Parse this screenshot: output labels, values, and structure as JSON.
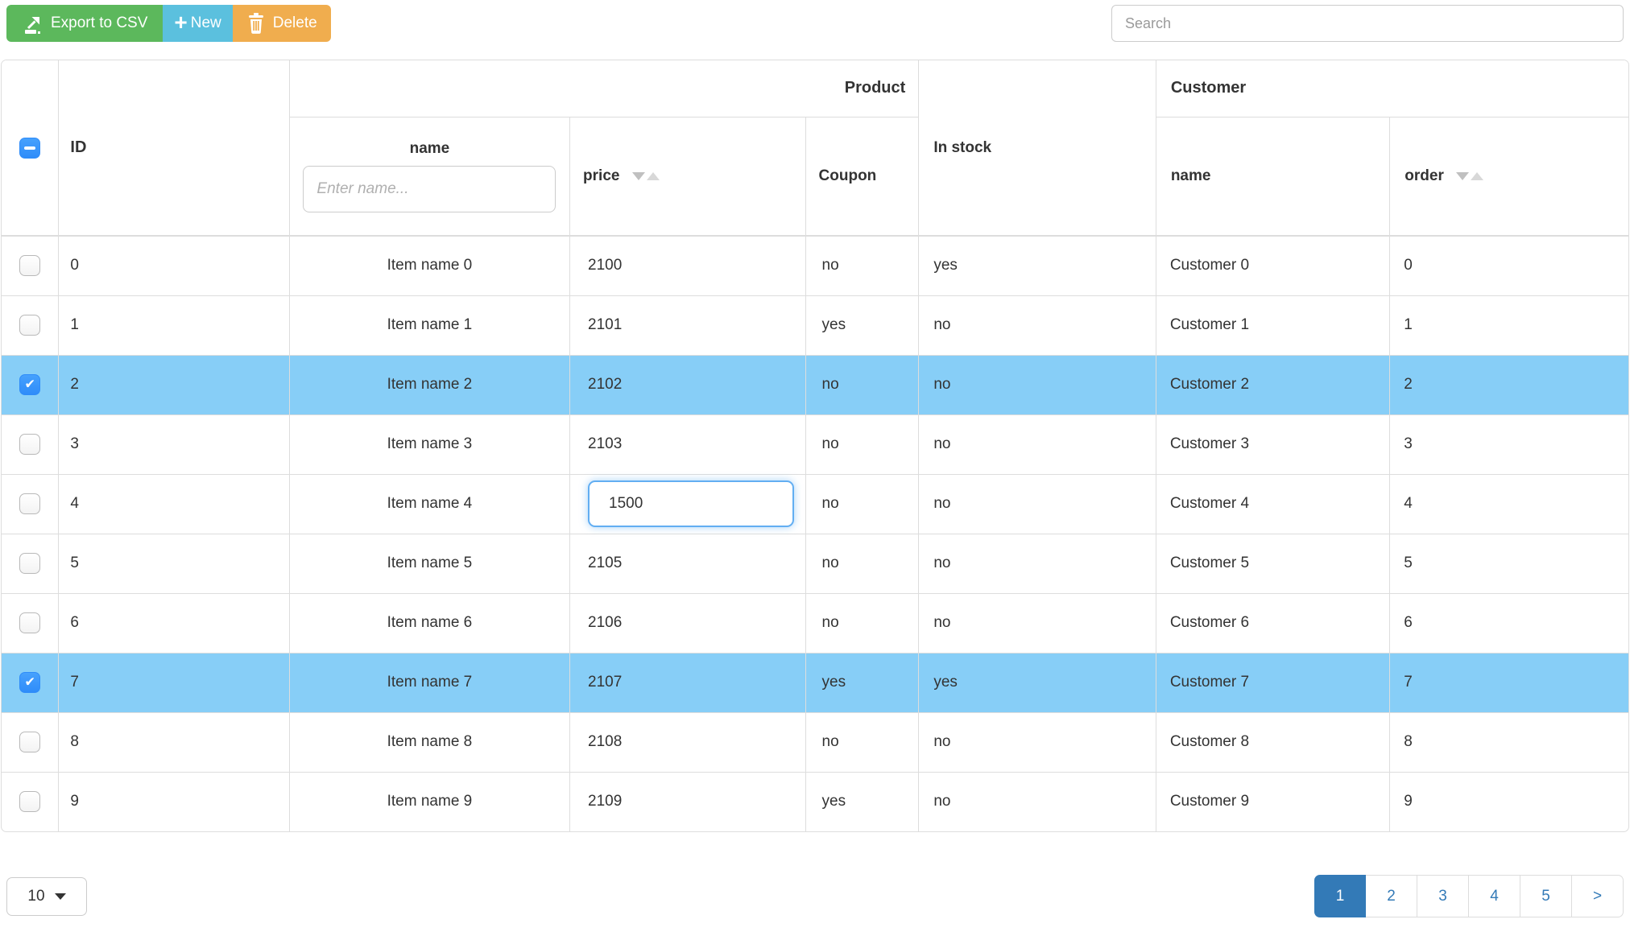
{
  "toolbar": {
    "export_label": "Export to CSV",
    "new_label": "New",
    "delete_label": "Delete"
  },
  "search": {
    "placeholder": "Search"
  },
  "table": {
    "groups": {
      "product": "Product",
      "customer": "Customer"
    },
    "columns": {
      "id": "ID",
      "product_name": "name",
      "price": "price",
      "coupon": "Coupon",
      "in_stock": "In stock",
      "customer_name": "name",
      "order": "order"
    },
    "name_filter_placeholder": "Enter name...",
    "rows": [
      {
        "id": "0",
        "name": "Item name 0",
        "price": "2100",
        "coupon": "no",
        "in_stock": "yes",
        "customer": "Customer 0",
        "order": "0",
        "selected": false,
        "editing": false
      },
      {
        "id": "1",
        "name": "Item name 1",
        "price": "2101",
        "coupon": "yes",
        "in_stock": "no",
        "customer": "Customer 1",
        "order": "1",
        "selected": false,
        "editing": false
      },
      {
        "id": "2",
        "name": "Item name 2",
        "price": "2102",
        "coupon": "no",
        "in_stock": "no",
        "customer": "Customer 2",
        "order": "2",
        "selected": true,
        "editing": false
      },
      {
        "id": "3",
        "name": "Item name 3",
        "price": "2103",
        "coupon": "no",
        "in_stock": "no",
        "customer": "Customer 3",
        "order": "3",
        "selected": false,
        "editing": false
      },
      {
        "id": "4",
        "name": "Item name 4",
        "price": "1500",
        "coupon": "no",
        "in_stock": "no",
        "customer": "Customer 4",
        "order": "4",
        "selected": false,
        "editing": true
      },
      {
        "id": "5",
        "name": "Item name 5",
        "price": "2105",
        "coupon": "no",
        "in_stock": "no",
        "customer": "Customer 5",
        "order": "5",
        "selected": false,
        "editing": false
      },
      {
        "id": "6",
        "name": "Item name 6",
        "price": "2106",
        "coupon": "no",
        "in_stock": "no",
        "customer": "Customer 6",
        "order": "6",
        "selected": false,
        "editing": false
      },
      {
        "id": "7",
        "name": "Item name 7",
        "price": "2107",
        "coupon": "yes",
        "in_stock": "yes",
        "customer": "Customer 7",
        "order": "7",
        "selected": true,
        "editing": false
      },
      {
        "id": "8",
        "name": "Item name 8",
        "price": "2108",
        "coupon": "no",
        "in_stock": "no",
        "customer": "Customer 8",
        "order": "8",
        "selected": false,
        "editing": false
      },
      {
        "id": "9",
        "name": "Item name 9",
        "price": "2109",
        "coupon": "yes",
        "in_stock": "no",
        "customer": "Customer 9",
        "order": "9",
        "selected": false,
        "editing": false
      }
    ]
  },
  "pagination": {
    "page_size": "10",
    "pages": [
      "1",
      "2",
      "3",
      "4",
      "5"
    ],
    "active_page": "1",
    "next_label": ">"
  },
  "icons": {
    "export": "export-icon",
    "new": "plus-icon",
    "delete": "trash-icon",
    "page_size": "caret-down-icon",
    "sort": "sort-both-icon"
  },
  "colors": {
    "export_button": "#5cb85c",
    "new_button": "#5bc0de",
    "delete_button": "#f0ad4e",
    "selected_row": "#87cef7",
    "active_page": "#337ab7",
    "checkbox_blue": "#3b99fc",
    "table_border": "#dddddd"
  }
}
